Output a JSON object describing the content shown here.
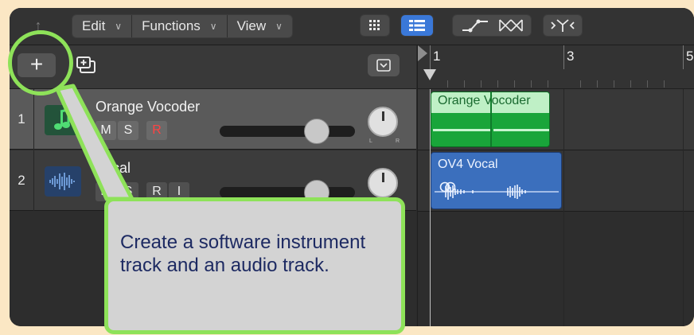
{
  "toolbar": {
    "back_icon": "up-arrow",
    "menus": [
      {
        "label": "Edit"
      },
      {
        "label": "Functions"
      },
      {
        "label": "View"
      }
    ],
    "view_icons": [
      "grid-view-icon",
      "list-view-icon",
      "automation-icon",
      "flex-icon",
      "catch-icon"
    ]
  },
  "row2": {
    "add_label": "+",
    "duplicate_icon": "duplicate-track-icon",
    "dropdown_icon": "chevron-down-icon"
  },
  "ruler": {
    "bars": [
      "1",
      "3",
      "5"
    ]
  },
  "tracks": [
    {
      "number": "1",
      "name": "Orange Vocoder",
      "icon": "software-instrument-icon",
      "buttons": [
        "M",
        "S",
        "R"
      ],
      "pan_labels": [
        "L",
        "R"
      ]
    },
    {
      "number": "2",
      "name": "Vocal",
      "icon": "audio-waveform-icon",
      "buttons": [
        "M",
        "S",
        "R",
        "I"
      ]
    }
  ],
  "regions": [
    {
      "name": "Orange Vocoder",
      "kind": "midi"
    },
    {
      "name": "OV4 Vocal",
      "kind": "audio",
      "icon": "stereo-rings-icon"
    }
  ],
  "callout": {
    "text": "Create a software instrument track and an audio track."
  },
  "colors": {
    "accent": "#8ee259",
    "midi_region": "#19a53a",
    "audio_region": "#3b6fbd",
    "record": "#ff4343"
  }
}
